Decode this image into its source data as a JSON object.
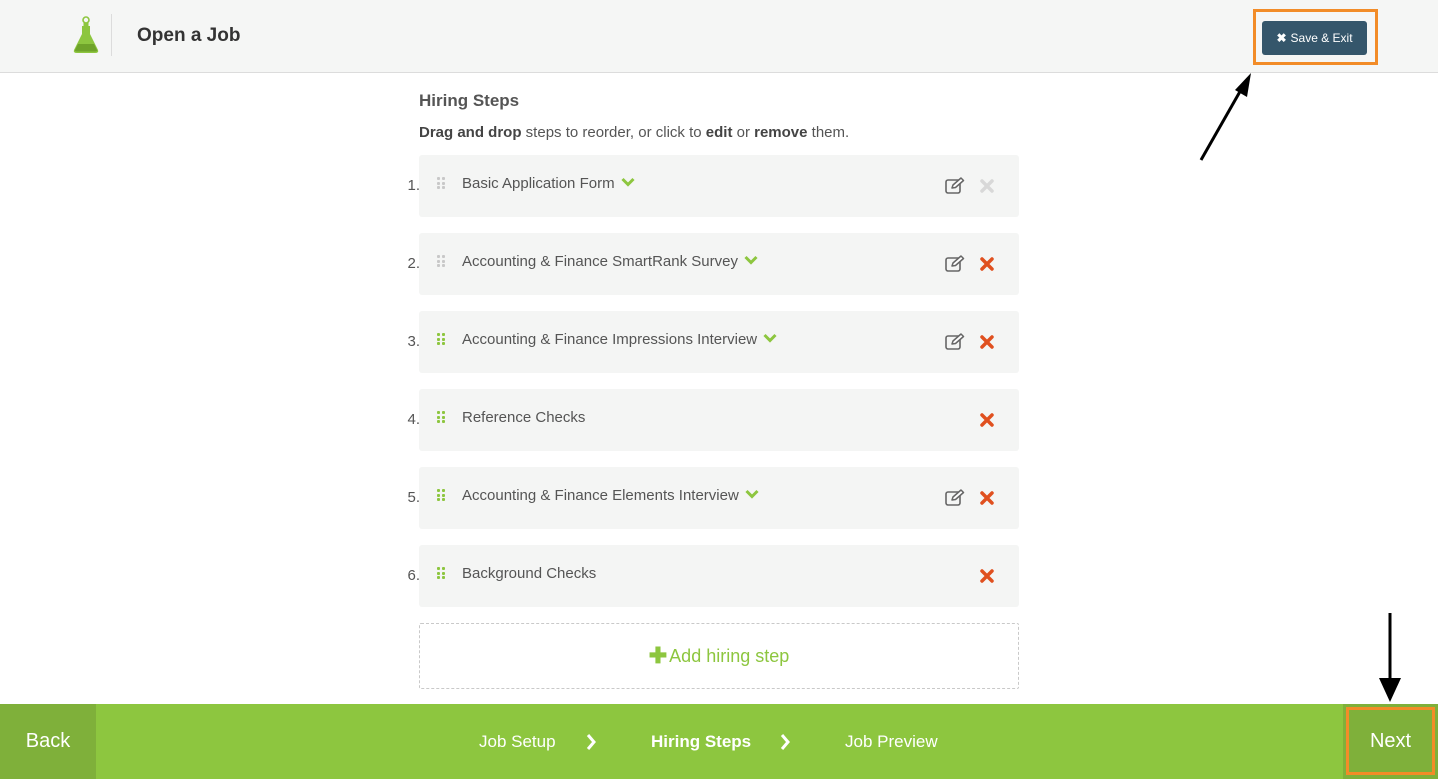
{
  "header": {
    "title": "Open a Job",
    "save_exit_label": "Save & Exit",
    "save_exit_icon": "x-icon"
  },
  "content": {
    "section_title": "Hiring Steps",
    "instructions": {
      "part1_bold": "Drag and drop",
      "part2": " steps to reorder, or click to ",
      "part3_bold": "edit",
      "part4": " or ",
      "part5_bold": "remove",
      "part6": " them."
    },
    "steps": [
      {
        "number": "1.",
        "label": "Basic Application Form",
        "expandable": true,
        "editable": true,
        "removable": false
      },
      {
        "number": "2.",
        "label": "Accounting & Finance SmartRank Survey",
        "expandable": true,
        "editable": true,
        "removable": true
      },
      {
        "number": "3.",
        "label": "Accounting & Finance Impressions Interview",
        "expandable": true,
        "editable": true,
        "removable": true
      },
      {
        "number": "4.",
        "label": "Reference Checks",
        "expandable": false,
        "editable": false,
        "removable": true
      },
      {
        "number": "5.",
        "label": "Accounting & Finance Elements Interview",
        "expandable": true,
        "editable": true,
        "removable": true
      },
      {
        "number": "6.",
        "label": "Background Checks",
        "expandable": false,
        "editable": false,
        "removable": true
      }
    ],
    "add_step_label": "Add hiring step"
  },
  "footer": {
    "back_label": "Back",
    "next_label": "Next",
    "breadcrumbs": [
      {
        "label": "Job Setup",
        "active": false
      },
      {
        "label": "Hiring Steps",
        "active": true
      },
      {
        "label": "Job Preview",
        "active": false
      }
    ]
  },
  "colors": {
    "brand_green": "#8dc63f",
    "header_button": "#35566b",
    "remove_red": "#e0501f",
    "highlight_orange": "#f28c28"
  }
}
